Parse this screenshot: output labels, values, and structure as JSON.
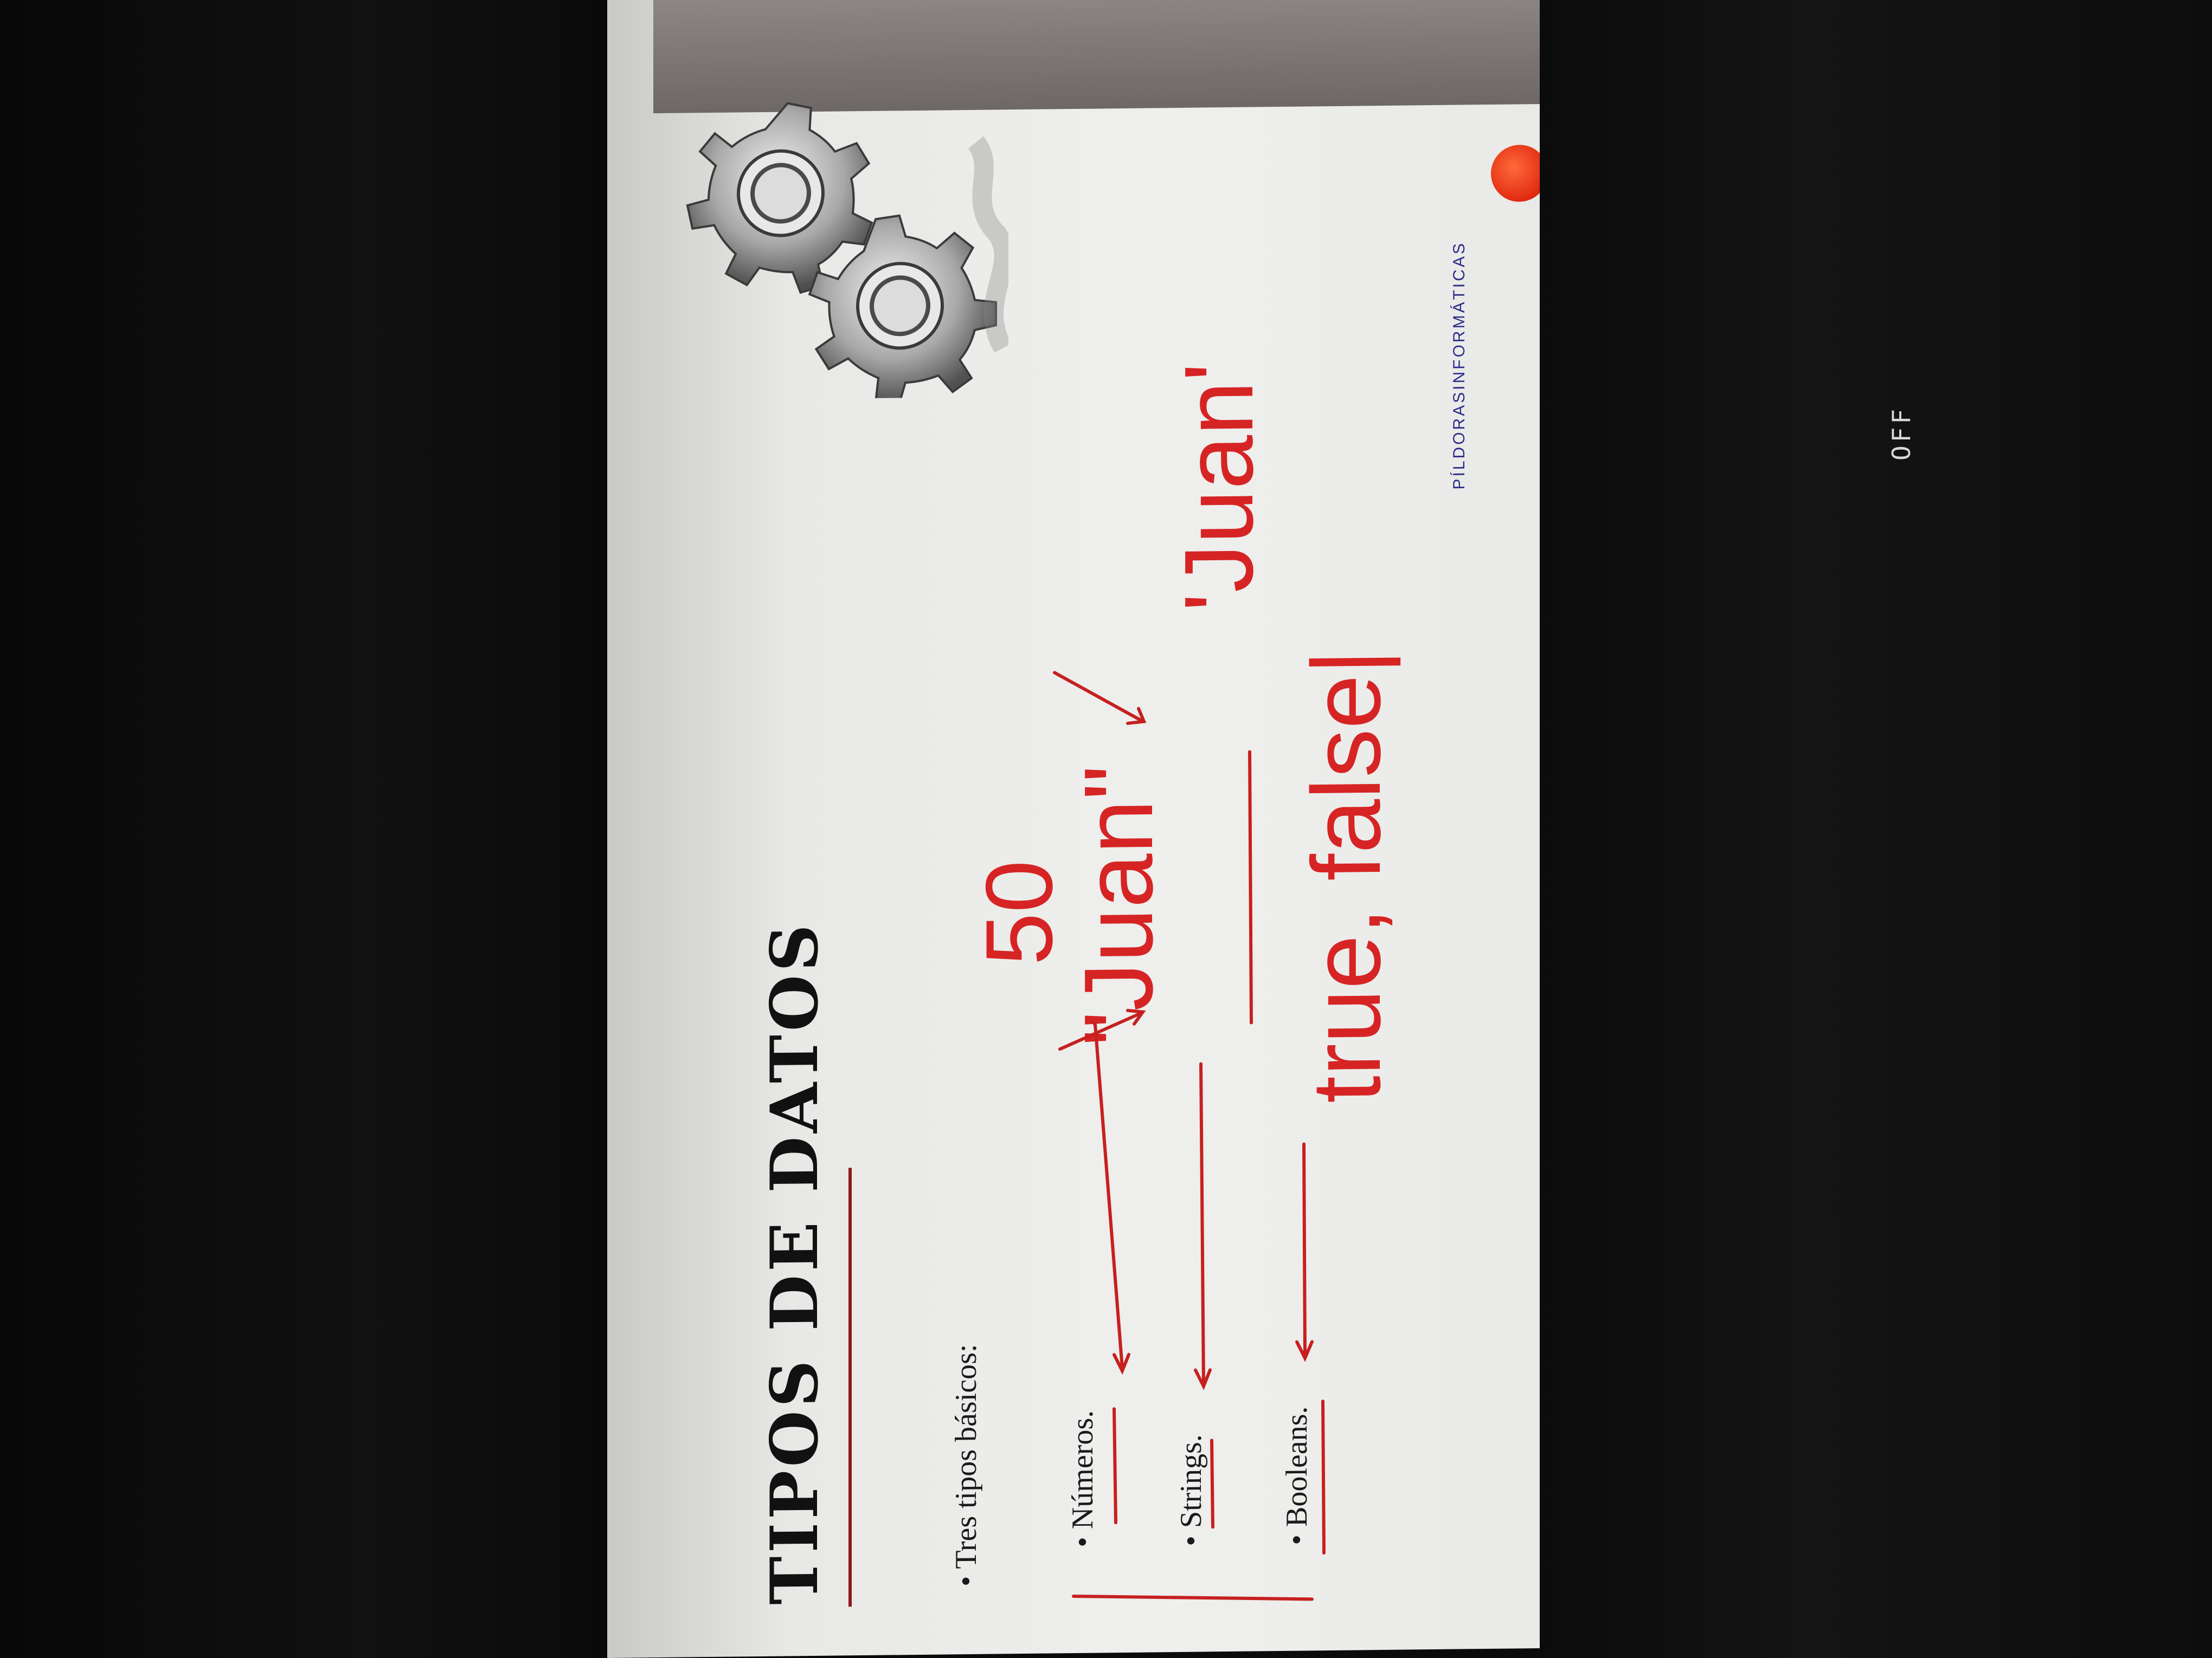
{
  "overlay": {
    "off_label": "OFF"
  },
  "slide": {
    "title": "TIPOS DE DATOS",
    "intro": "• Tres tipos básicos:",
    "bullets": [
      "• Números.",
      "• Strings.",
      "• Booleans."
    ],
    "logo": "PÍLDORASINFORMÁTICAS"
  },
  "annotations": {
    "number_example": "50",
    "string_example_double": "\"Juan\"",
    "string_example_single": "'Juan'",
    "boolean_example": "true, false|"
  },
  "colors": {
    "annotation_red": "#d62424",
    "logo_blue": "#2b2b8c",
    "logo_orange": "#e02a10"
  },
  "icons": [
    "gears-icon",
    "logo-circle-icon"
  ]
}
